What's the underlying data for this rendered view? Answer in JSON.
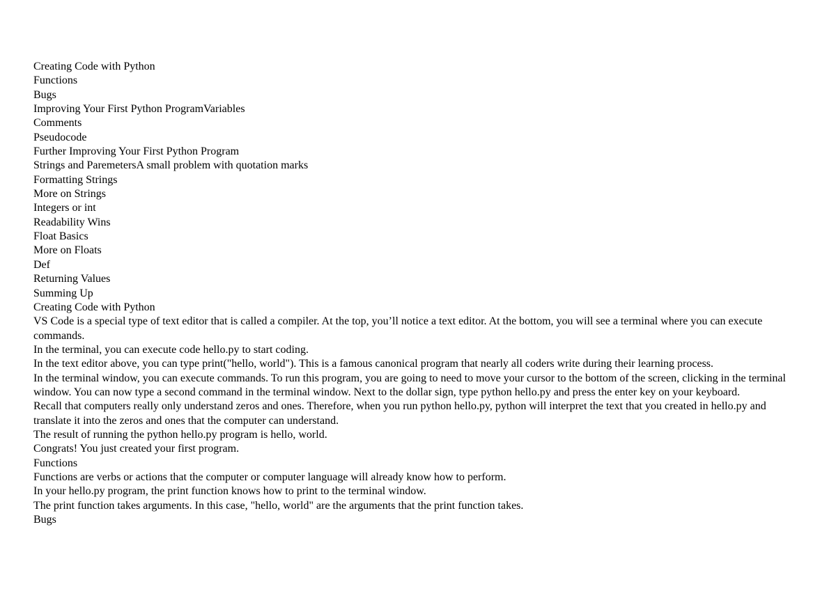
{
  "document": {
    "title": "Creating Code with Python",
    "text_color": "#000000",
    "page_background": "#ffffff",
    "toc": [
      {
        "label": "Creating Code with Python"
      },
      {
        "label": "Functions"
      },
      {
        "label": "Bugs"
      },
      {
        "label": "Improving Your First Python ProgramVariables"
      },
      {
        "label": "Comments"
      },
      {
        "label": "Pseudocode"
      },
      {
        "label": "Further Improving Your First Python Program"
      },
      {
        "label": "Strings and ParemetersA small problem with quotation marks"
      },
      {
        "label": "Formatting Strings"
      },
      {
        "label": "More on Strings"
      },
      {
        "label": "Integers or int"
      },
      {
        "label": "Readability Wins"
      },
      {
        "label": "Float Basics"
      },
      {
        "label": "More on Floats"
      },
      {
        "label": "Def"
      },
      {
        "label": "Returning Values"
      },
      {
        "label": "Summing Up"
      }
    ],
    "body": [
      {
        "type": "heading",
        "text": "Creating Code with Python"
      },
      {
        "type": "paragraph",
        "text": "VS Code is a special type of text editor that is called a compiler. At the top, you’ll notice a text editor. At the bottom, you will see a terminal where you can execute commands."
      },
      {
        "type": "paragraph",
        "text": "In the terminal, you can execute code hello.py to start coding."
      },
      {
        "type": "paragraph",
        "text": "In the text editor above, you can type print(\"hello, world\"). This is a famous canonical program that nearly all coders write during their learning process."
      },
      {
        "type": "paragraph",
        "text": "In the terminal window, you can execute commands. To run this program, you are going to need to move your cursor to the bottom of the screen, clicking in the terminal window. You can now type a second command in the terminal window. Next to the dollar sign, type python hello.py and press the enter key on your keyboard."
      },
      {
        "type": "paragraph",
        "text": "Recall that computers really only understand zeros and ones. Therefore, when you run python hello.py, python will interpret the text that you created in hello.py and translate it into the zeros and ones that the computer can understand."
      },
      {
        "type": "paragraph",
        "text": "The result of running the python hello.py program is hello, world."
      },
      {
        "type": "paragraph",
        "text": "Congrats! You just created your first program."
      },
      {
        "type": "heading",
        "text": "Functions"
      },
      {
        "type": "paragraph",
        "text": "Functions are verbs or actions that the computer or computer language will already know how to perform."
      },
      {
        "type": "paragraph",
        "text": "In your hello.py program, the print function knows how to print to the terminal window."
      },
      {
        "type": "paragraph",
        "text": "The print function takes arguments. In this case, \"hello, world\" are the arguments that the print function takes."
      },
      {
        "type": "heading",
        "text": "Bugs"
      }
    ]
  }
}
